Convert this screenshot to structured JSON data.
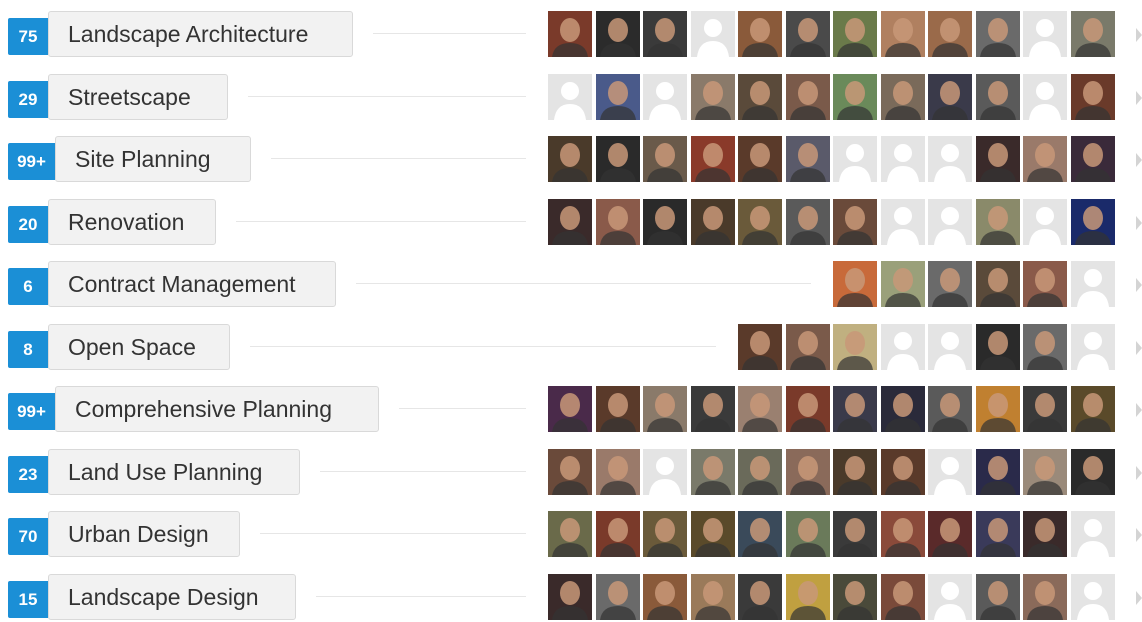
{
  "skills": [
    {
      "count": "75",
      "name": "Landscape Architecture",
      "photos": [
        "#7a3a2a",
        "#2b2b2b",
        "#3a3a3a",
        "ph",
        "#8a5a3a",
        "#4a4a4a",
        "#6a7a4a",
        "#b08060",
        "#9a6a4a",
        "#6a6a6a",
        "ph",
        "#7a7a6a"
      ]
    },
    {
      "count": "29",
      "name": "Streetscape",
      "photos": [
        "ph",
        "#4a5a8a",
        "ph",
        "#8a7a6a",
        "#5a4a3a",
        "#7a5a4a",
        "#6a8a5a",
        "#7a6a5a",
        "#3a3a4a",
        "#5a5a5a",
        "ph",
        "#6a3a2a"
      ]
    },
    {
      "count": "99+",
      "name": "Site Planning",
      "photos": [
        "#4a3a2a",
        "#2a2a2a",
        "#6a5a4a",
        "#8a3a2a",
        "#5a3a2a",
        "#5a5a6a",
        "ph",
        "ph",
        "ph",
        "#3a2a2a",
        "#9a7a6a",
        "#3a2a3a"
      ]
    },
    {
      "count": "20",
      "name": "Renovation",
      "photos": [
        "#3a2a2a",
        "#8a5a4a",
        "#2a2a2a",
        "#4a3a2a",
        "#6a5a3a",
        "#5a5a5a",
        "#6a4a3a",
        "ph",
        "ph",
        "#8a8a6a",
        "ph",
        "#1a2a6a"
      ]
    },
    {
      "count": "6",
      "name": "Contract Management",
      "photos": [
        "#c86a3a",
        "#9aa07a",
        "#6a6a6a",
        "#5a4a3a",
        "#8a5a4a",
        "ph"
      ]
    },
    {
      "count": "8",
      "name": "Open Space",
      "photos": [
        "#5a3a2a",
        "#7a5a4a",
        "#c0b080",
        "ph",
        "ph",
        "#2a2a2a",
        "#6a6a6a",
        "ph"
      ]
    },
    {
      "count": "99+",
      "name": "Comprehensive Planning",
      "photos": [
        "#4a2a4a",
        "#5a3a2a",
        "#8a7a6a",
        "#3a3a3a",
        "#9a8070",
        "#7a3a2a",
        "#3a3a4a",
        "#2a2a3a",
        "#5a5a5a",
        "#c08030",
        "#3a3a3a",
        "#5a4a2a"
      ]
    },
    {
      "count": "23",
      "name": "Land Use Planning",
      "photos": [
        "#6a4a3a",
        "#9a7a6a",
        "ph",
        "#7a7a6a",
        "#6a6a5a",
        "#8a6a5a",
        "#4a3a2a",
        "#5a3a2a",
        "ph",
        "#2a2a4a",
        "#9a8a7a",
        "#2a2a2a"
      ]
    },
    {
      "count": "70",
      "name": "Urban Design",
      "photos": [
        "#6a6a4a",
        "#7a3a2a",
        "#6a5a3a",
        "#5a4a2a",
        "#3a4a5a",
        "#6a7a5a",
        "#3a3a3a",
        "#8a4a3a",
        "#5a2a2a",
        "#3a3a5a",
        "#3a2a2a",
        "ph"
      ]
    },
    {
      "count": "15",
      "name": "Landscape Design",
      "photos": [
        "#3a2a2a",
        "#6a6a6a",
        "#8a5a3a",
        "#9a7a5a",
        "#3a3a3a",
        "#c0a040",
        "#4a4a3a",
        "#7a4a3a",
        "ph",
        "#5a5a5a",
        "#8a6a5a",
        "ph"
      ]
    }
  ]
}
